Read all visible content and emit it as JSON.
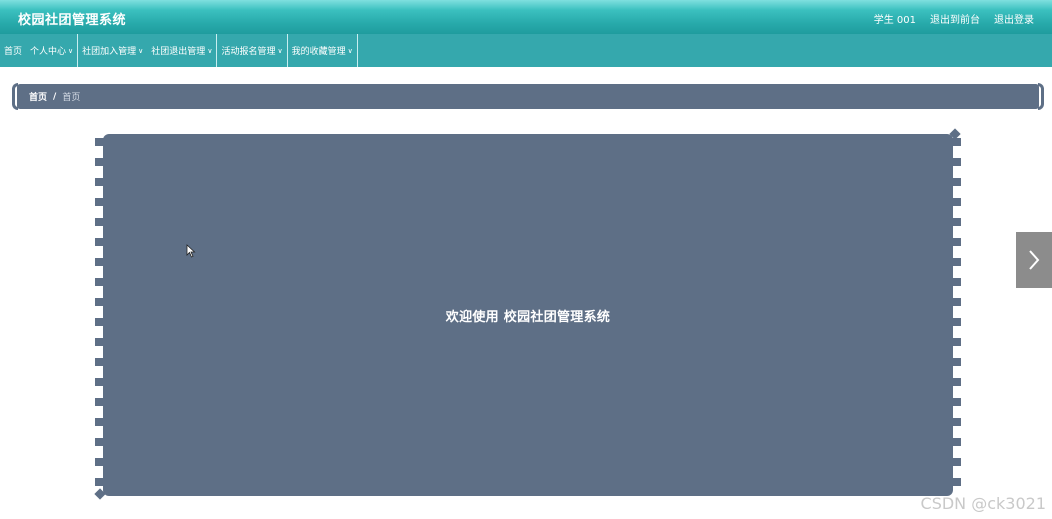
{
  "header": {
    "title": "校园社团管理系统",
    "user": "学生 001",
    "back_to_front": "退出到前台",
    "logout": "退出登录"
  },
  "nav": {
    "items": [
      {
        "label": "首页",
        "dropdown": false
      },
      {
        "label": "个人中心",
        "dropdown": true
      },
      {
        "label": "社团加入管理",
        "dropdown": true
      },
      {
        "label": "社团退出管理",
        "dropdown": true
      },
      {
        "label": "活动报名管理",
        "dropdown": true
      },
      {
        "label": "我的收藏管理",
        "dropdown": true
      }
    ]
  },
  "breadcrumb": {
    "home": "首页",
    "separator": "/",
    "current": "首页"
  },
  "main": {
    "welcome": "欢迎使用 校园社团管理系统"
  },
  "icons": {
    "next": "chevron-right-icon",
    "dropdown": "chevron-down-icon",
    "cursor": "mouse-pointer-icon"
  },
  "watermark": "CSDN @ck3021",
  "colors": {
    "header_teal": "#27a9aa",
    "nav_teal": "#35a8ad",
    "panel_slate": "#5e6f86",
    "side_arrow_gray": "#8c8c8c"
  }
}
